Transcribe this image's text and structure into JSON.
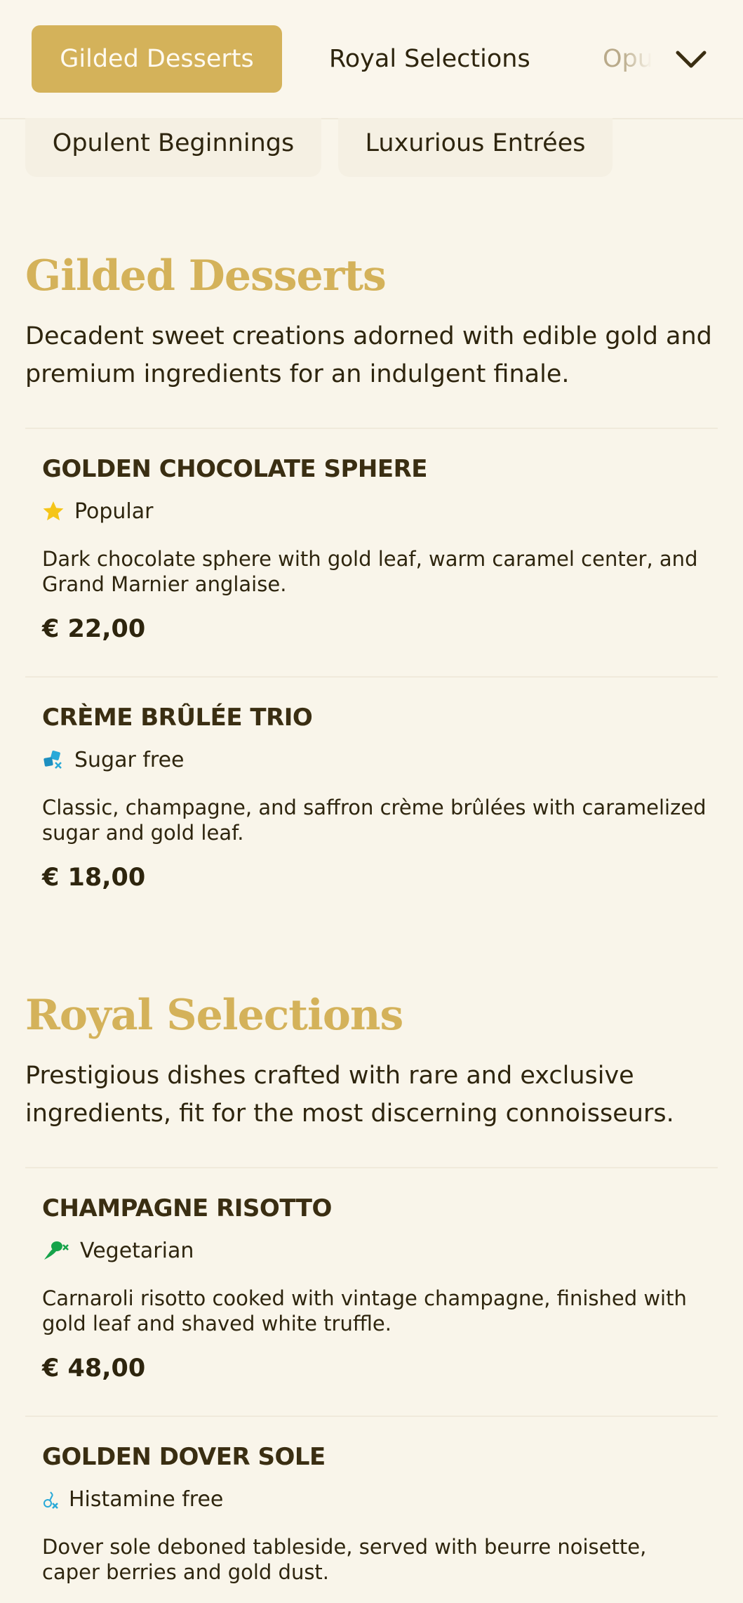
{
  "nav": {
    "tabs": [
      {
        "label": "Gilded Desserts",
        "active": true
      },
      {
        "label": "Royal Selections",
        "active": false
      },
      {
        "label": "Opulent Beginnings",
        "active": false
      }
    ],
    "dropdown_icon": "chevron-down-icon",
    "overflow_tabs": [
      {
        "label": "Opulent Beginnings"
      },
      {
        "label": "Luxurious Entrées"
      }
    ]
  },
  "colors": {
    "accent": "#d4b25a",
    "background": "#f9f5ea",
    "text": "#3a2e12"
  },
  "sections": [
    {
      "title": "Gilded Desserts",
      "description": "Decadent sweet creations adorned with edible gold and premium ingredients for an indulgent finale.",
      "items": [
        {
          "name": "GOLDEN CHOCOLATE SPHERE",
          "badge": {
            "icon": "star-icon",
            "label": "Popular"
          },
          "description": "Dark chocolate sphere with gold leaf, warm caramel center, and Grand Marnier anglaise.",
          "price": "€ 22,00"
        },
        {
          "name": "CRÈME BRÛLÉE TRIO",
          "badge": {
            "icon": "sugar-free-icon",
            "label": "Sugar free"
          },
          "description": "Classic, champagne, and saffron crème brûlées with caramelized sugar and gold leaf.",
          "price": "€ 18,00"
        }
      ]
    },
    {
      "title": "Royal Selections",
      "description": "Prestigious dishes crafted with rare and exclusive ingredients, fit for the most discerning connoisseurs.",
      "items": [
        {
          "name": "CHAMPAGNE RISOTTO",
          "badge": {
            "icon": "vegetarian-icon",
            "label": "Vegetarian"
          },
          "description": "Carnaroli risotto cooked with vintage champagne, finished with gold leaf and shaved white truffle.",
          "price": "€ 48,00"
        },
        {
          "name": "GOLDEN DOVER SOLE",
          "badge": {
            "icon": "histamine-free-icon",
            "label": "Histamine free"
          },
          "description": "Dover sole deboned tableside, served with beurre noisette, caper berries and gold dust.",
          "price": ""
        }
      ]
    }
  ]
}
